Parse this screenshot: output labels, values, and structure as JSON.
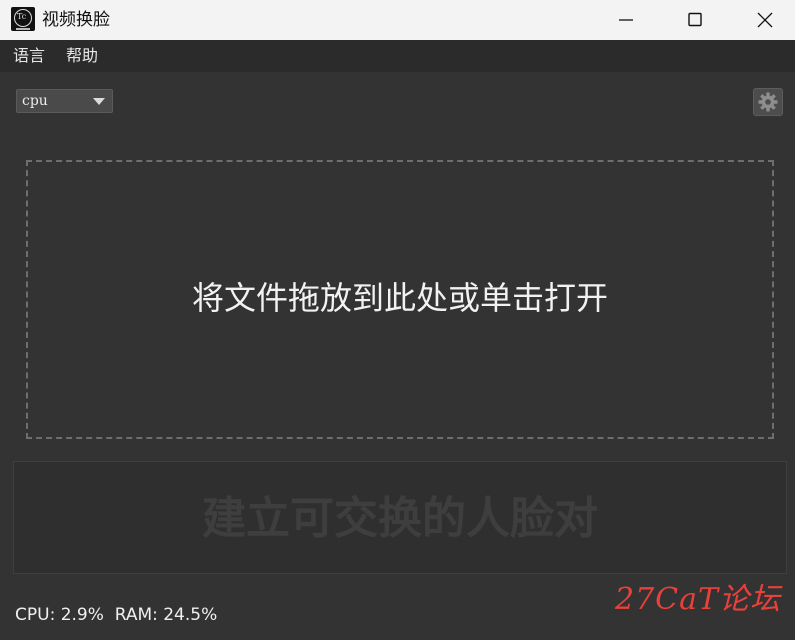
{
  "window": {
    "title": "视频换脸"
  },
  "menu": {
    "items": [
      "语言",
      "帮助"
    ]
  },
  "toolbar": {
    "device_select_value": "cpu",
    "settings_icon": "gear-icon"
  },
  "dropzone": {
    "text": "将文件拖放到此处或单击打开"
  },
  "facepair": {
    "text": "建立可交换的人脸对"
  },
  "status": {
    "text": "CPU: 2.9%  RAM: 24.5%"
  },
  "watermark": {
    "text": "27CaT论坛"
  },
  "colors": {
    "background": "#333333",
    "titlebar": "#f3f3f3",
    "watermark": "#e8403a"
  }
}
